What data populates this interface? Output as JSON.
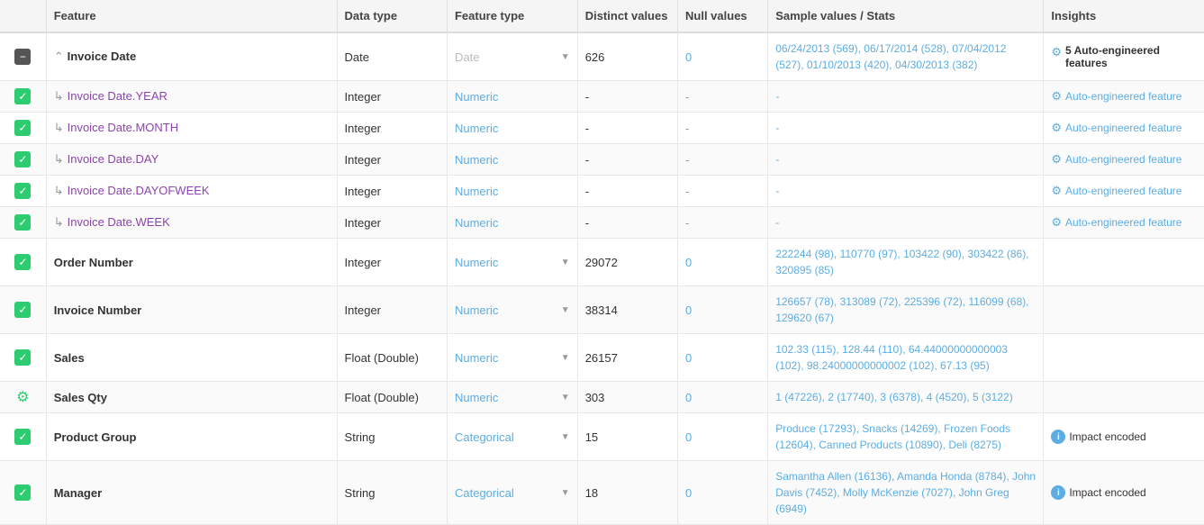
{
  "header": {
    "col_checkbox": "",
    "col_feature": "Feature",
    "col_datatype": "Data type",
    "col_featuretype": "Feature type",
    "col_distinct": "Distinct values",
    "col_null": "Null values",
    "col_sample": "Sample values / Stats",
    "col_insights": "Insights"
  },
  "rows": [
    {
      "id": "invoice-date",
      "checkbox": "minus",
      "feature": "Invoice Date",
      "feature_sub": false,
      "indent": false,
      "datatype": "Date",
      "featuretype": "Date",
      "featuretype_color": "date",
      "has_dropdown": true,
      "distinct": "626",
      "null_val": "0",
      "null_type": "zero",
      "sample": "06/24/2013 (569), 06/17/2014 (528), 07/04/2012 (527), 01/10/2013 (420), 04/30/2013 (382)",
      "insights_type": "auto-bold",
      "insights_text": "5 Auto-engineered features"
    },
    {
      "id": "invoice-date-year",
      "checkbox": "green",
      "feature": "Invoice Date.YEAR",
      "feature_sub": true,
      "indent": true,
      "datatype": "Integer",
      "featuretype": "Numeric",
      "featuretype_color": "numeric",
      "has_dropdown": false,
      "distinct": "-",
      "null_val": "-",
      "null_type": "dash",
      "sample": "-",
      "insights_type": "auto-link",
      "insights_text": "Auto-engineered feature"
    },
    {
      "id": "invoice-date-month",
      "checkbox": "green",
      "feature": "Invoice Date.MONTH",
      "feature_sub": true,
      "indent": true,
      "datatype": "Integer",
      "featuretype": "Numeric",
      "featuretype_color": "numeric",
      "has_dropdown": false,
      "distinct": "-",
      "null_val": "-",
      "null_type": "dash",
      "sample": "-",
      "insights_type": "auto-link",
      "insights_text": "Auto-engineered feature"
    },
    {
      "id": "invoice-date-day",
      "checkbox": "green",
      "feature": "Invoice Date.DAY",
      "feature_sub": true,
      "indent": true,
      "datatype": "Integer",
      "featuretype": "Numeric",
      "featuretype_color": "numeric",
      "has_dropdown": false,
      "distinct": "-",
      "null_val": "-",
      "null_type": "dash",
      "sample": "-",
      "insights_type": "auto-link",
      "insights_text": "Auto-engineered feature"
    },
    {
      "id": "invoice-date-dayofweek",
      "checkbox": "green",
      "feature": "Invoice Date.DAYOFWEEK",
      "feature_sub": true,
      "indent": true,
      "datatype": "Integer",
      "featuretype": "Numeric",
      "featuretype_color": "numeric",
      "has_dropdown": false,
      "distinct": "-",
      "null_val": "-",
      "null_type": "dash",
      "sample": "-",
      "insights_type": "auto-link",
      "insights_text": "Auto-engineered feature"
    },
    {
      "id": "invoice-date-week",
      "checkbox": "green",
      "feature": "Invoice Date.WEEK",
      "feature_sub": true,
      "indent": true,
      "datatype": "Integer",
      "featuretype": "Numeric",
      "featuretype_color": "numeric",
      "has_dropdown": false,
      "distinct": "-",
      "null_val": "-",
      "null_type": "dash",
      "sample": "-",
      "insights_type": "auto-link",
      "insights_text": "Auto-engineered feature"
    },
    {
      "id": "order-number",
      "checkbox": "green",
      "feature": "Order Number",
      "feature_sub": false,
      "indent": false,
      "datatype": "Integer",
      "featuretype": "Numeric",
      "featuretype_color": "numeric",
      "has_dropdown": true,
      "distinct": "29072",
      "null_val": "0",
      "null_type": "zero",
      "sample": "222244 (98), 110770 (97), 103422 (90), 303422 (86), 320895 (85)",
      "insights_type": "none",
      "insights_text": ""
    },
    {
      "id": "invoice-number",
      "checkbox": "green",
      "feature": "Invoice Number",
      "feature_sub": false,
      "indent": false,
      "datatype": "Integer",
      "featuretype": "Numeric",
      "featuretype_color": "numeric",
      "has_dropdown": true,
      "distinct": "38314",
      "null_val": "0",
      "null_type": "zero",
      "sample": "126657 (78), 313089 (72), 225396 (72), 116099 (68), 129620 (67)",
      "insights_type": "none",
      "insights_text": ""
    },
    {
      "id": "sales",
      "checkbox": "green",
      "feature": "Sales",
      "feature_sub": false,
      "indent": false,
      "datatype": "Float (Double)",
      "featuretype": "Numeric",
      "featuretype_color": "numeric",
      "has_dropdown": true,
      "distinct": "26157",
      "null_val": "0",
      "null_type": "zero",
      "sample": "102.33 (115), 128.44 (110), 64.44000000000003 (102), 98.24000000000002 (102), 67.13 (95)",
      "insights_type": "none",
      "insights_text": ""
    },
    {
      "id": "sales-qty",
      "checkbox": "target",
      "feature": "Sales Qty",
      "feature_sub": false,
      "indent": false,
      "datatype": "Float (Double)",
      "featuretype": "Numeric",
      "featuretype_color": "numeric",
      "has_dropdown": true,
      "distinct": "303",
      "null_val": "0",
      "null_type": "zero",
      "sample": "1 (47226), 2 (17740), 3 (6378), 4 (4520), 5 (3122)",
      "insights_type": "none",
      "insights_text": ""
    },
    {
      "id": "product-group",
      "checkbox": "green",
      "feature": "Product Group",
      "feature_sub": false,
      "indent": false,
      "datatype": "String",
      "featuretype": "Categorical",
      "featuretype_color": "numeric",
      "has_dropdown": true,
      "distinct": "15",
      "null_val": "0",
      "null_type": "zero",
      "sample": "Produce (17293), Snacks (14269), Frozen Foods (12604), Canned Products (10890), Deli (8275)",
      "insights_type": "impact",
      "insights_text": "Impact encoded"
    },
    {
      "id": "manager",
      "checkbox": "green",
      "feature": "Manager",
      "feature_sub": false,
      "indent": false,
      "datatype": "String",
      "featuretype": "Categorical",
      "featuretype_color": "numeric",
      "has_dropdown": true,
      "distinct": "18",
      "null_val": "0",
      "null_type": "zero",
      "sample": "Samantha Allen (16136), Amanda Honda (8784), John Davis (7452), Molly McKenzie (7027), John Greg (6949)",
      "insights_type": "impact",
      "insights_text": "Impact encoded"
    }
  ]
}
